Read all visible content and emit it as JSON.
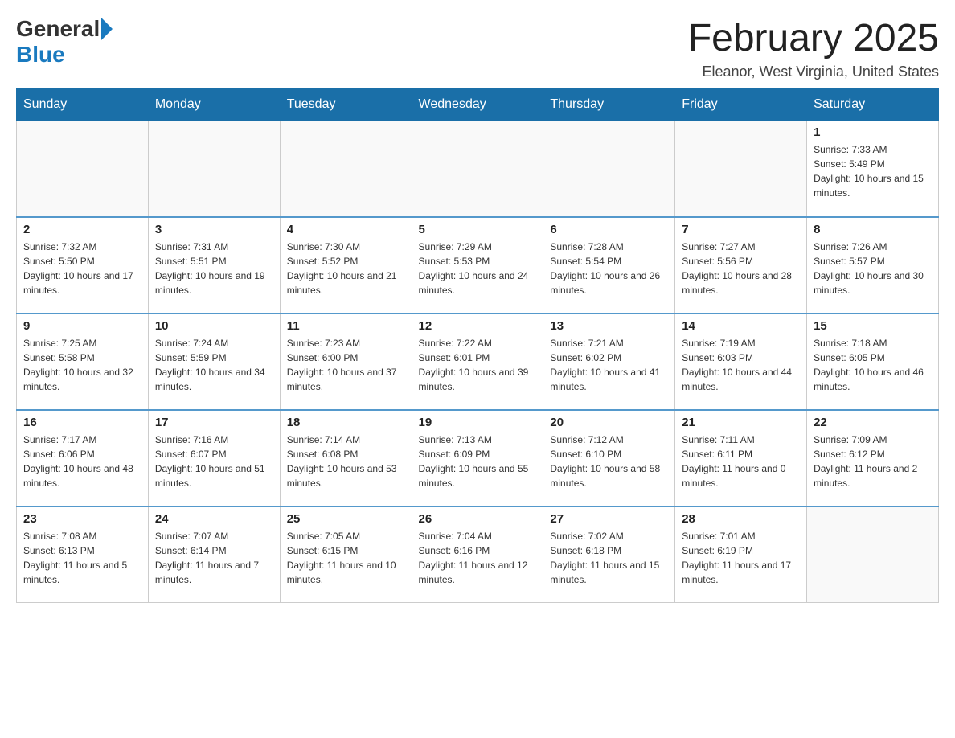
{
  "header": {
    "logo_general": "General",
    "logo_blue": "Blue",
    "month_title": "February 2025",
    "location": "Eleanor, West Virginia, United States"
  },
  "days_of_week": [
    "Sunday",
    "Monday",
    "Tuesday",
    "Wednesday",
    "Thursday",
    "Friday",
    "Saturday"
  ],
  "weeks": [
    {
      "days": [
        {
          "number": "",
          "info": ""
        },
        {
          "number": "",
          "info": ""
        },
        {
          "number": "",
          "info": ""
        },
        {
          "number": "",
          "info": ""
        },
        {
          "number": "",
          "info": ""
        },
        {
          "number": "",
          "info": ""
        },
        {
          "number": "1",
          "info": "Sunrise: 7:33 AM\nSunset: 5:49 PM\nDaylight: 10 hours and 15 minutes."
        }
      ]
    },
    {
      "days": [
        {
          "number": "2",
          "info": "Sunrise: 7:32 AM\nSunset: 5:50 PM\nDaylight: 10 hours and 17 minutes."
        },
        {
          "number": "3",
          "info": "Sunrise: 7:31 AM\nSunset: 5:51 PM\nDaylight: 10 hours and 19 minutes."
        },
        {
          "number": "4",
          "info": "Sunrise: 7:30 AM\nSunset: 5:52 PM\nDaylight: 10 hours and 21 minutes."
        },
        {
          "number": "5",
          "info": "Sunrise: 7:29 AM\nSunset: 5:53 PM\nDaylight: 10 hours and 24 minutes."
        },
        {
          "number": "6",
          "info": "Sunrise: 7:28 AM\nSunset: 5:54 PM\nDaylight: 10 hours and 26 minutes."
        },
        {
          "number": "7",
          "info": "Sunrise: 7:27 AM\nSunset: 5:56 PM\nDaylight: 10 hours and 28 minutes."
        },
        {
          "number": "8",
          "info": "Sunrise: 7:26 AM\nSunset: 5:57 PM\nDaylight: 10 hours and 30 minutes."
        }
      ]
    },
    {
      "days": [
        {
          "number": "9",
          "info": "Sunrise: 7:25 AM\nSunset: 5:58 PM\nDaylight: 10 hours and 32 minutes."
        },
        {
          "number": "10",
          "info": "Sunrise: 7:24 AM\nSunset: 5:59 PM\nDaylight: 10 hours and 34 minutes."
        },
        {
          "number": "11",
          "info": "Sunrise: 7:23 AM\nSunset: 6:00 PM\nDaylight: 10 hours and 37 minutes."
        },
        {
          "number": "12",
          "info": "Sunrise: 7:22 AM\nSunset: 6:01 PM\nDaylight: 10 hours and 39 minutes."
        },
        {
          "number": "13",
          "info": "Sunrise: 7:21 AM\nSunset: 6:02 PM\nDaylight: 10 hours and 41 minutes."
        },
        {
          "number": "14",
          "info": "Sunrise: 7:19 AM\nSunset: 6:03 PM\nDaylight: 10 hours and 44 minutes."
        },
        {
          "number": "15",
          "info": "Sunrise: 7:18 AM\nSunset: 6:05 PM\nDaylight: 10 hours and 46 minutes."
        }
      ]
    },
    {
      "days": [
        {
          "number": "16",
          "info": "Sunrise: 7:17 AM\nSunset: 6:06 PM\nDaylight: 10 hours and 48 minutes."
        },
        {
          "number": "17",
          "info": "Sunrise: 7:16 AM\nSunset: 6:07 PM\nDaylight: 10 hours and 51 minutes."
        },
        {
          "number": "18",
          "info": "Sunrise: 7:14 AM\nSunset: 6:08 PM\nDaylight: 10 hours and 53 minutes."
        },
        {
          "number": "19",
          "info": "Sunrise: 7:13 AM\nSunset: 6:09 PM\nDaylight: 10 hours and 55 minutes."
        },
        {
          "number": "20",
          "info": "Sunrise: 7:12 AM\nSunset: 6:10 PM\nDaylight: 10 hours and 58 minutes."
        },
        {
          "number": "21",
          "info": "Sunrise: 7:11 AM\nSunset: 6:11 PM\nDaylight: 11 hours and 0 minutes."
        },
        {
          "number": "22",
          "info": "Sunrise: 7:09 AM\nSunset: 6:12 PM\nDaylight: 11 hours and 2 minutes."
        }
      ]
    },
    {
      "days": [
        {
          "number": "23",
          "info": "Sunrise: 7:08 AM\nSunset: 6:13 PM\nDaylight: 11 hours and 5 minutes."
        },
        {
          "number": "24",
          "info": "Sunrise: 7:07 AM\nSunset: 6:14 PM\nDaylight: 11 hours and 7 minutes."
        },
        {
          "number": "25",
          "info": "Sunrise: 7:05 AM\nSunset: 6:15 PM\nDaylight: 11 hours and 10 minutes."
        },
        {
          "number": "26",
          "info": "Sunrise: 7:04 AM\nSunset: 6:16 PM\nDaylight: 11 hours and 12 minutes."
        },
        {
          "number": "27",
          "info": "Sunrise: 7:02 AM\nSunset: 6:18 PM\nDaylight: 11 hours and 15 minutes."
        },
        {
          "number": "28",
          "info": "Sunrise: 7:01 AM\nSunset: 6:19 PM\nDaylight: 11 hours and 17 minutes."
        },
        {
          "number": "",
          "info": ""
        }
      ]
    }
  ]
}
